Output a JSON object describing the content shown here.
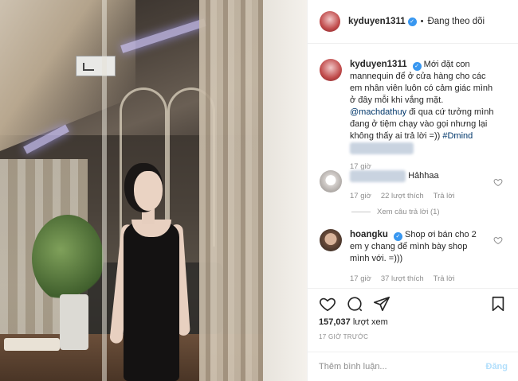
{
  "header": {
    "username": "kyduyen1311",
    "follow_status": "Đang theo dõi"
  },
  "caption": {
    "username": "kyduyen1311",
    "text": "Mới đặt con mannequin để ở cửa hàng cho các em nhân viên luôn có cảm giác mình ở đây mỗi khi vắng mặt.",
    "mention": "@machdathuy",
    "text2": " đi qua cứ tưởng mình đang ở tiệm chạy vào gọi nhưng lại không thấy ai trả lời =)) ",
    "hashtag": "#Dmind",
    "time": "17 giờ"
  },
  "comments": [
    {
      "username": "",
      "text": "Hảhhaa",
      "time": "17 giờ",
      "likes": "22 lượt thích",
      "reply": "Trả lời",
      "view_replies": "Xem câu trả lời (1)"
    },
    {
      "username": "hoangku",
      "text": "Shop ơi bán cho 2 em y chang để mình bày shop mình với. =)))",
      "time": "17 giờ",
      "likes": "37 lượt thích",
      "reply": "Trả lời"
    }
  ],
  "stats": {
    "views_count": "157,037",
    "views_label": "lượt xem",
    "posted": "17 GIỜ TRƯỚC"
  },
  "compose": {
    "placeholder": "Thêm bình luận...",
    "post_label": "Đăng"
  },
  "icons": [
    "heart-icon",
    "comment-icon",
    "share-icon",
    "bookmark-icon",
    "verified-icon"
  ]
}
